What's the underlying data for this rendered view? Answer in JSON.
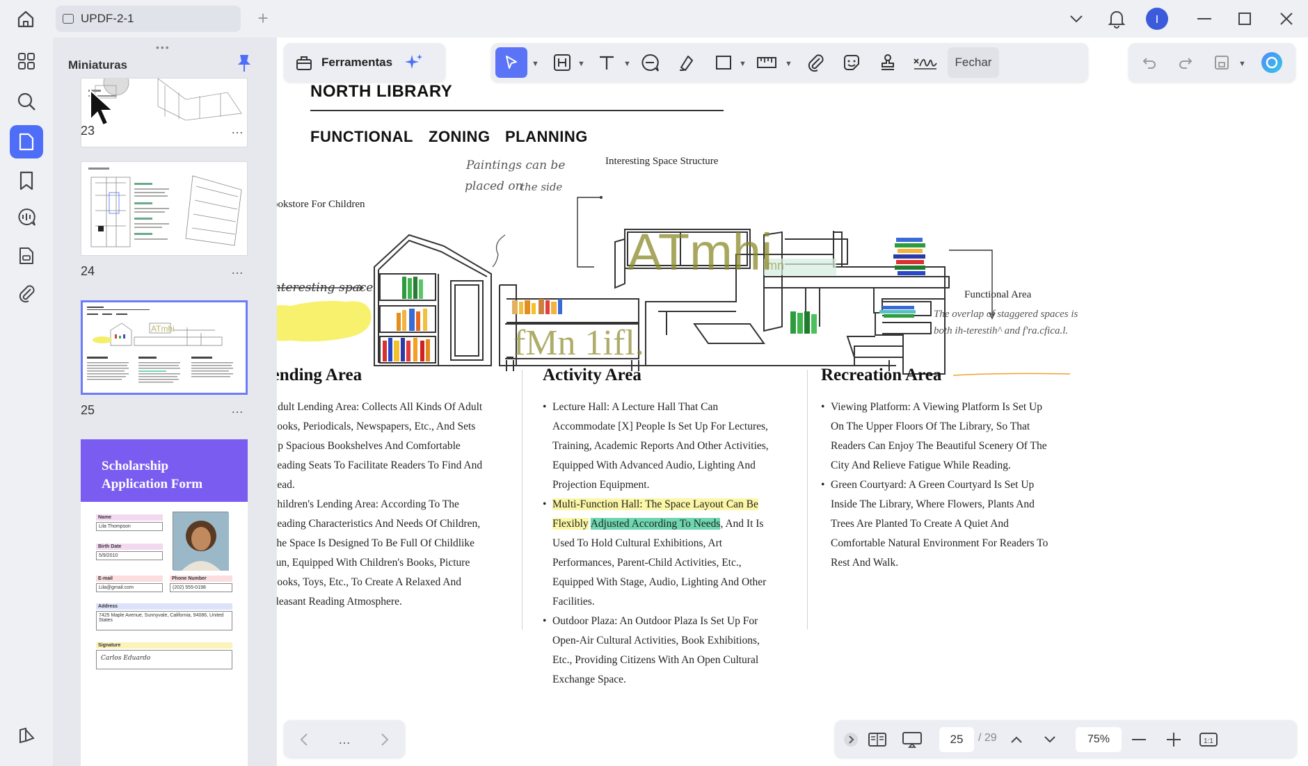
{
  "window": {
    "tab_title": "UPDF-2-1",
    "add_tab": "+"
  },
  "thumbnails": {
    "title": "Miniaturas",
    "grip": "•••",
    "more": "…",
    "pages": [
      {
        "num": "23"
      },
      {
        "num": "24"
      },
      {
        "num": "25"
      }
    ],
    "next_preview": {
      "title_line1": "Scholarship",
      "title_line2": "Application Form",
      "fields": {
        "name_label": "Name",
        "name_value": "Lila Thompson",
        "birth_label": "Birth Date",
        "birth_value": "5/9/2010",
        "email_label": "E-mail",
        "email_value": "Lila@gmail.com",
        "phone_label": "Phone Number",
        "phone_value": "(202) 555-0198",
        "address_label": "Address",
        "address_value": "7425 Maple Avenue, Sunnyvale, California, 94086, United States",
        "signature_label": "Signature",
        "signature_value": "Carlos Eduardo"
      }
    }
  },
  "toolbar": {
    "tools_label": "Ferramentas",
    "close_label": "Fechar"
  },
  "document": {
    "title": "NORTH LIBRARY",
    "subtitle": [
      "FUNCTIONAL",
      "ZONING",
      "PLANNING"
    ],
    "drawing": {
      "note_paintings_1": "Paintings can be",
      "note_paintings_2": "placed on",
      "note_paintings_3": "the side",
      "label_structure": "Interesting Space Structure",
      "label_bookstore": "Bookstore For Children",
      "label_interesting": "Interesting space",
      "label_functional": "Functional Area",
      "overlap_1": "The overlap of staggered spaces is",
      "overlap_2": "both ih-terestih^ and f'ra.cfica.l.",
      "ocr_artifact_1": "ATmhi",
      "ocr_artifact_1_tail": "mn",
      "ocr_artifact_2": "fMn 1ifl."
    },
    "columns": [
      {
        "heading": "Lending Area",
        "items": [
          "Adult Lending Area: Collects All Kinds Of Adult Books, Periodicals, Newspapers, Etc., And Sets Up Spacious Bookshelves And Comfortable Reading Seats To Facilitate Readers To Find And Read.",
          "Children's Lending Area: According To The Reading Characteristics And Needs Of Children, The Space Is Designed To Be Full Of Childlike Fun, Equipped With Children's Books, Picture Books, Toys, Etc., To Create A Relaxed And Pleasant Reading Atmosphere."
        ]
      },
      {
        "heading": "Activity Area",
        "items": [
          "Lecture Hall: A Lecture Hall That Can Accommodate [X] People Is Set Up For Lectures, Training, Academic Reports And Other Activities, Equipped With Advanced Audio, Lighting And Projection Equipment.",
          "Outdoor Plaza: An Outdoor Plaza Is Set Up For Open-Air Cultural Activities, Book Exhibitions, Etc., Providing Citizens With An Open Cultural Exchange Space."
        ],
        "highlight_item": {
          "hl_yellow": "Multi-Function Hall: The Space Layout Can Be Flexibly",
          "hl_green": "Adjusted According To Needs",
          "rest": ", And It Is Used To Hold Cultural Exhibitions, Art Performances, Parent-Child Activities, Etc., Equipped With Stage, Audio, Lighting And Other Facilities."
        }
      },
      {
        "heading": "Recreation Area",
        "items": [
          "Viewing Platform: A Viewing Platform Is Set Up On The Upper Floors Of The Library, So That Readers Can Enjoy The Beautiful Scenery Of The City And Relieve Fatigue While Reading.",
          "Green Courtyard: A Green Courtyard Is Set Up Inside The Library, Where Flowers, Plants And Trees Are Planted To Create A Quiet And Comfortable Natural Environment For Readers To Rest And Walk."
        ]
      }
    ]
  },
  "bottom_bar": {
    "nav_more": "…",
    "current_page": "25",
    "total_pages": "/ 29",
    "zoom": "75%",
    "fit_label": "1:1"
  },
  "colors": {
    "accent": "#4f6ef7",
    "highlight_yellow": "#fbf7a6",
    "highlight_green": "#6ed7b0",
    "scholarship_purple": "#7b5cf0"
  }
}
